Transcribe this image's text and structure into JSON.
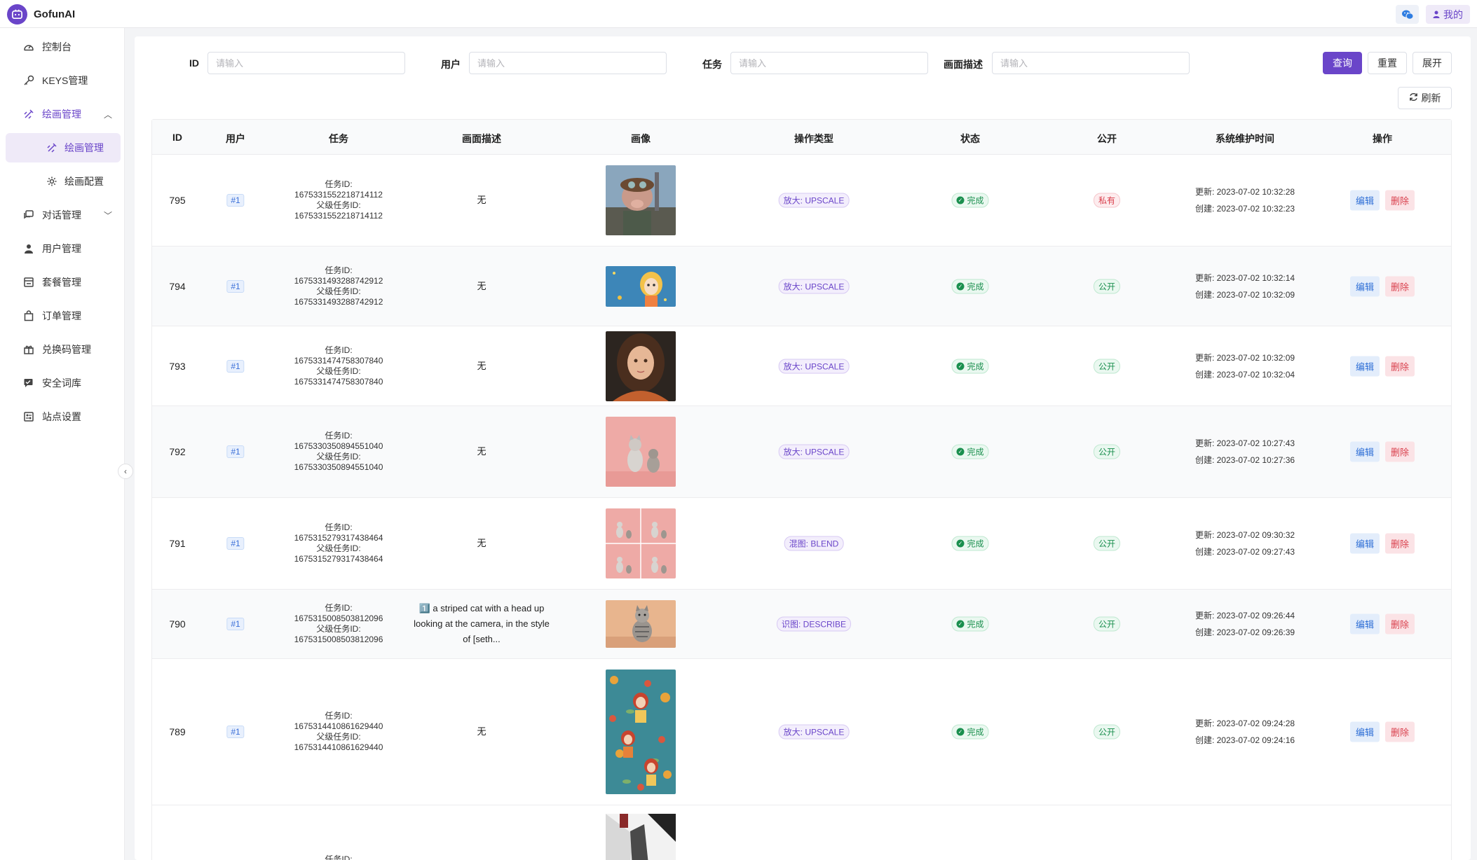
{
  "app": {
    "name": "GofunAI"
  },
  "header": {
    "user_label": "我的"
  },
  "sidebar": {
    "items": [
      {
        "label": "控制台",
        "icon": "dashboard-icon"
      },
      {
        "label": "KEYS管理",
        "icon": "key-icon"
      },
      {
        "label": "绘画管理",
        "icon": "paint-icon"
      },
      {
        "label": "绘画管理",
        "icon": "paint-icon"
      },
      {
        "label": "绘画配置",
        "icon": "gear-icon"
      },
      {
        "label": "对话管理",
        "icon": "chat-icon"
      },
      {
        "label": "用户管理",
        "icon": "user-icon"
      },
      {
        "label": "套餐管理",
        "icon": "package-icon"
      },
      {
        "label": "订单管理",
        "icon": "bag-icon"
      },
      {
        "label": "兑换码管理",
        "icon": "gift-icon"
      },
      {
        "label": "安全词库",
        "icon": "shield-chat-icon"
      },
      {
        "label": "站点设置",
        "icon": "settings-panel-icon"
      }
    ]
  },
  "filters": {
    "id_label": "ID",
    "user_label": "用户",
    "task_label": "任务",
    "desc_label": "画面描述",
    "placeholder": "请输入",
    "query_button": "查询",
    "reset_button": "重置",
    "expand_button": "展开",
    "refresh_button": "刷新"
  },
  "table": {
    "columns": [
      "ID",
      "用户",
      "任务",
      "画面描述",
      "画像",
      "操作类型",
      "状态",
      "公开",
      "系统维护时间",
      "操作"
    ],
    "task_id_label": "任务ID:",
    "parent_task_id_label": "父级任务ID:",
    "updated_label": "更新:",
    "created_label": "创建:",
    "edit_label": "编辑",
    "delete_label": "删除",
    "rows": [
      {
        "id": "795",
        "user": "#1",
        "task_id": "1675331552218714112",
        "parent_task_id": "1675331552218714112",
        "desc": "无",
        "op": "放大: UPSCALE",
        "status": "完成",
        "public": "私有",
        "updated": "2023-07-02 10:32:28",
        "created": "2023-07-02 10:32:23",
        "image": "pig-pilot"
      },
      {
        "id": "794",
        "user": "#1",
        "task_id": "1675331493288742912",
        "parent_task_id": "1675331493288742912",
        "desc": "无",
        "op": "放大: UPSCALE",
        "status": "完成",
        "public": "公开",
        "updated": "2023-07-02 10:32:14",
        "created": "2023-07-02 10:32:09",
        "image": "cartoon-girl"
      },
      {
        "id": "793",
        "user": "#1",
        "task_id": "1675331474758307840",
        "parent_task_id": "1675331474758307840",
        "desc": "无",
        "op": "放大: UPSCALE",
        "status": "完成",
        "public": "公开",
        "updated": "2023-07-02 10:32:09",
        "created": "2023-07-02 10:32:04",
        "image": "portrait-girl"
      },
      {
        "id": "792",
        "user": "#1",
        "task_id": "1675330350894551040",
        "parent_task_id": "1675330350894551040",
        "desc": "无",
        "op": "放大: UPSCALE",
        "status": "完成",
        "public": "公开",
        "updated": "2023-07-02 10:27:43",
        "created": "2023-07-02 10:27:36",
        "image": "two-cats"
      },
      {
        "id": "791",
        "user": "#1",
        "task_id": "1675315279317438464",
        "parent_task_id": "1675315279317438464",
        "desc": "无",
        "op": "混图: BLEND",
        "status": "完成",
        "public": "公开",
        "updated": "2023-07-02 09:30:32",
        "created": "2023-07-02 09:27:43",
        "image": "cat-grid"
      },
      {
        "id": "790",
        "user": "#1",
        "task_id": "1675315008503812096",
        "parent_task_id": "1675315008503812096",
        "desc": "1️⃣ a striped cat with a head up looking at the camera, in the style of [seth...",
        "op": "识图: DESCRIBE",
        "status": "完成",
        "public": "公开",
        "updated": "2023-07-02 09:26:44",
        "created": "2023-07-02 09:26:39",
        "image": "striped-cat"
      },
      {
        "id": "789",
        "user": "#1",
        "task_id": "1675314410861629440",
        "parent_task_id": "1675314410861629440",
        "desc": "无",
        "op": "放大: UPSCALE",
        "status": "完成",
        "public": "公开",
        "updated": "2023-07-02 09:24:28",
        "created": "2023-07-02 09:24:16",
        "image": "floral-pattern"
      }
    ],
    "partial_row": {
      "task_id_label": "任务ID:"
    }
  }
}
